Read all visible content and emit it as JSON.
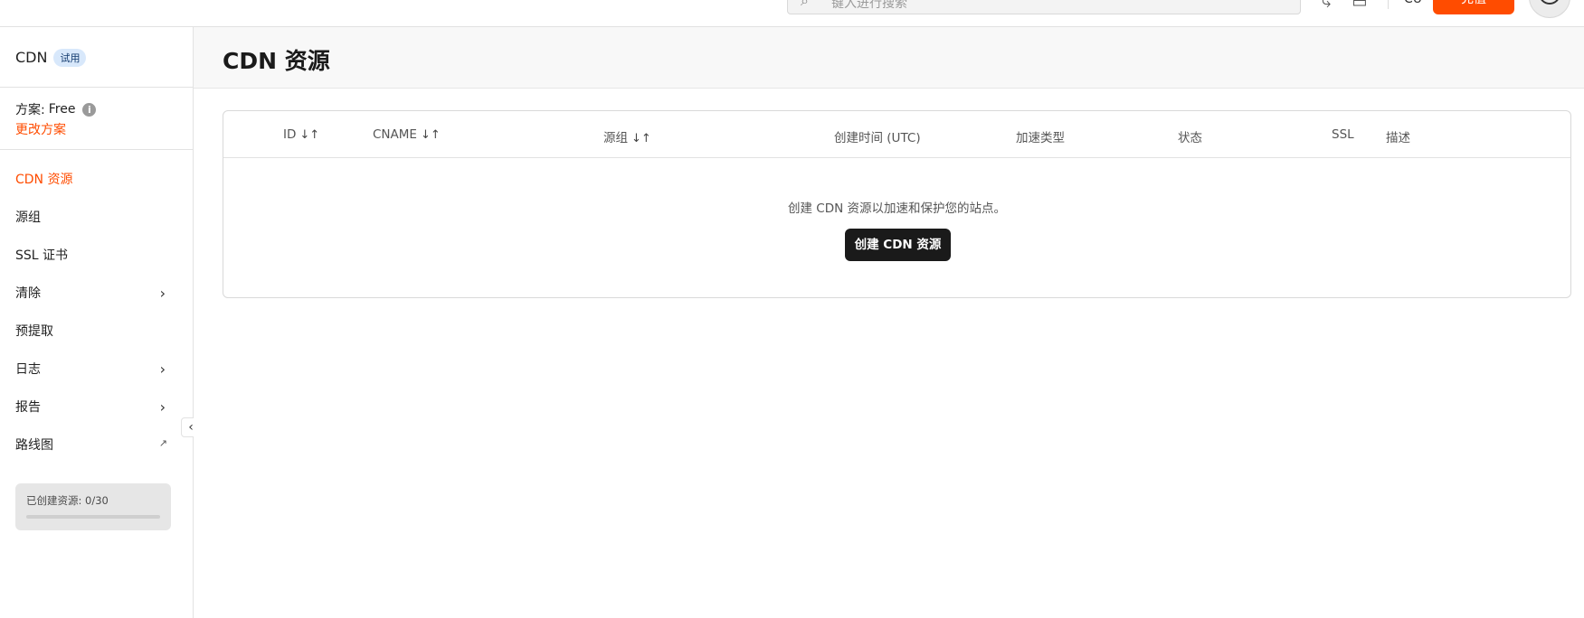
{
  "topbar": {
    "search_placeholder": "键入进行搜索",
    "lang": "CU",
    "primary_button": "充值"
  },
  "sidebar": {
    "product": "CDN",
    "badge": "试用",
    "plan_label": "方案:",
    "plan_value": "Free",
    "change_plan": "更改方案",
    "items": [
      {
        "label": "CDN 资源",
        "active": true
      },
      {
        "label": "源组"
      },
      {
        "label": "SSL 证书"
      },
      {
        "label": "清除",
        "chevron": true
      },
      {
        "label": "预提取"
      },
      {
        "label": "日志",
        "chevron": true
      },
      {
        "label": "报告",
        "chevron": true
      },
      {
        "label": "路线图",
        "external": true
      }
    ],
    "usage": {
      "label": "已创建资源: 0/30",
      "used": 0,
      "total": 30
    }
  },
  "main": {
    "title": "CDN 资源",
    "columns": [
      {
        "label": "ID",
        "sort": "↓↑"
      },
      {
        "label": "CNAME",
        "sort": "↓↑"
      },
      {
        "label": "源组",
        "sort": "↓↑"
      },
      {
        "label": "创建时间 (UTC)"
      },
      {
        "label": "加速类型"
      },
      {
        "label": "状态"
      },
      {
        "label": "SSL"
      },
      {
        "label": "描述"
      }
    ],
    "empty_message": "创建 CDN 资源以加速和保护您的站点。",
    "create_button": "创建 CDN 资源"
  },
  "colors": {
    "accent": "#ff4c00",
    "dark_button": "#1a1a1a",
    "badge_bg": "#d8e8fb"
  }
}
